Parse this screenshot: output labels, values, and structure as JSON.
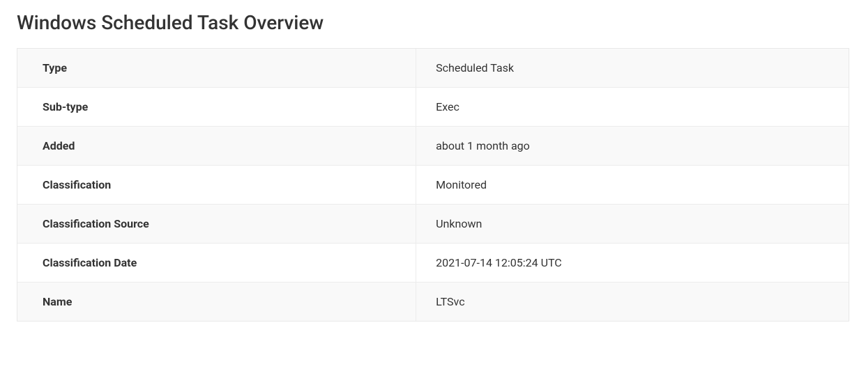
{
  "title": "Windows Scheduled Task Overview",
  "rows": [
    {
      "label": "Type",
      "value": "Scheduled Task"
    },
    {
      "label": "Sub-type",
      "value": "Exec"
    },
    {
      "label": "Added",
      "value": "about 1 month ago"
    },
    {
      "label": "Classification",
      "value": "Monitored"
    },
    {
      "label": "Classification Source",
      "value": "Unknown"
    },
    {
      "label": "Classification Date",
      "value": "2021-07-14 12:05:24 UTC"
    },
    {
      "label": "Name",
      "value": "LTSvc"
    }
  ]
}
